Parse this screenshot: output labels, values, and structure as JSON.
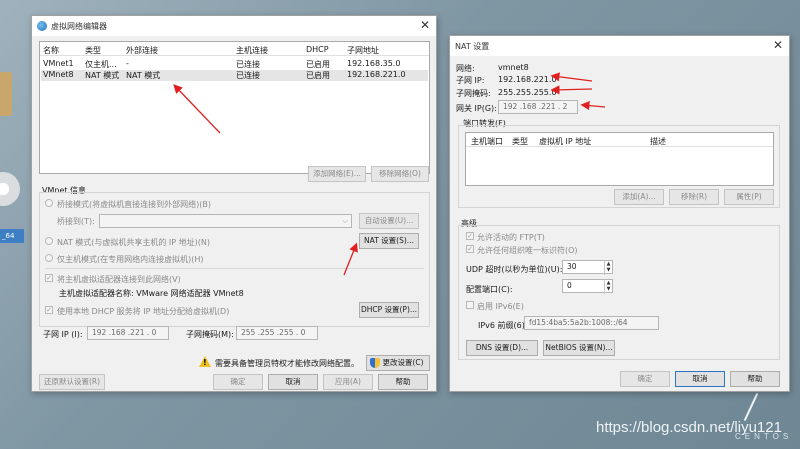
{
  "desktop": {
    "label": "_64",
    "watermark": "https://blog.csdn.net/liyu121",
    "brand": "CENTOS"
  },
  "editor": {
    "title": "虚拟网络编辑器",
    "close": "✕",
    "columns": [
      "名称",
      "类型",
      "外部连接",
      "主机连接",
      "DHCP",
      "子网地址"
    ],
    "rows": [
      [
        "VMnet1",
        "仅主机...",
        "-",
        "已连接",
        "已启用",
        "192.168.35.0"
      ],
      [
        "VMnet8",
        "NAT 模式",
        "NAT 模式",
        "已连接",
        "已启用",
        "192.168.221.0"
      ]
    ],
    "add_network": "添加网络(E)...",
    "remove_network": "移除网络(O)",
    "vmnet_info": "VMnet 信息",
    "bridge_mode": "桥接模式(将虚拟机直接连接到外部网络)(B)",
    "bridged_to": "桥接到(T):",
    "auto_settings": "自动设置(U)...",
    "nat_mode": "NAT 模式(与虚拟机共享主机的 IP 地址)(N)",
    "nat_settings": "NAT 设置(S)...",
    "host_only": "仅主机模式(在专用网络内连接虚拟机)(H)",
    "connect_adapter": "将主机虚拟适配器连接到此网络(V)",
    "adapter_name": "主机虚拟适配器名称: VMware 网络适配器 VMnet8",
    "use_dhcp": "使用本地 DHCP 服务将 IP 地址分配给虚拟机(D)",
    "dhcp_settings": "DHCP 设置(P)...",
    "subnet_ip_label": "子网 IP (I):",
    "subnet_ip": "192 .168 .221 . 0",
    "subnet_mask_label": "子网掩码(M):",
    "subnet_mask": "255 .255 .255 . 0",
    "admin_notice": "需要具备管理员特权才能修改网络配置。",
    "change_settings": "更改设置(C)",
    "restore_defaults": "还原默认设置(R)",
    "ok": "确定",
    "cancel": "取消",
    "apply": "应用(A)",
    "help": "帮助"
  },
  "nat": {
    "title": "NAT 设置",
    "close": "✕",
    "network_label": "网络:",
    "network": "vmnet8",
    "subnet_ip_label": "子网 IP:",
    "subnet_ip": "192.168.221.0",
    "subnet_mask_label": "子网掩码:",
    "subnet_mask": "255.255.255.0",
    "gateway_label": "网关 IP(G):",
    "gateway": "192 .168 .221 . 2",
    "port_forwarding": "端口转发(F)",
    "pf_columns": [
      "主机端口",
      "类型",
      "虚拟机 IP 地址",
      "描述"
    ],
    "add": "添加(A)...",
    "remove": "移除(R)",
    "properties": "属性(P)",
    "advanced": "高级",
    "allow_ftp": "允许活动的 FTP(T)",
    "allow_any_oui": "允许任何组织唯一标识符(O)",
    "udp_timeout_label": "UDP 超时(以秒为单位)(U):",
    "udp_timeout": "30",
    "config_port_label": "配置端口(C):",
    "config_port": "0",
    "enable_ipv6": "启用 IPv6(E)",
    "ipv6_prefix_label": "IPv6 前缀(6):",
    "ipv6_prefix": "fd15:4ba5:5a2b:1008::/64",
    "dns_settings": "DNS 设置(D)...",
    "netbios_settings": "NetBIOS 设置(N)...",
    "ok": "确定",
    "cancel": "取消",
    "help": "帮助"
  },
  "colors": {
    "annotation_arrow": "#e02020",
    "focus_border": "#2a73c5"
  }
}
